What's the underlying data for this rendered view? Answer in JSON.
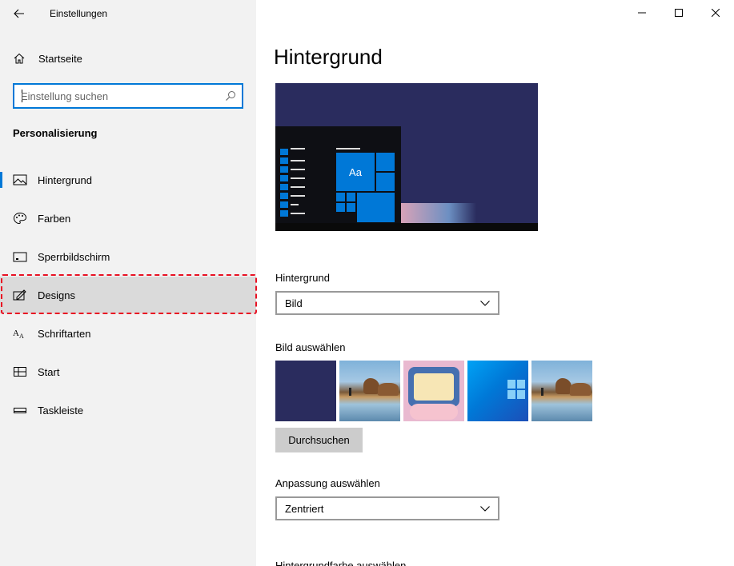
{
  "window": {
    "title": "Einstellungen",
    "controls": {
      "minimize": "minimize-icon",
      "maximize": "maximize-icon",
      "close": "close-icon"
    }
  },
  "sidebar": {
    "home_label": "Startseite",
    "search": {
      "placeholder": "Einstellung suchen",
      "value": ""
    },
    "section_title": "Personalisierung",
    "selected": "Hintergrund",
    "highlighted": "Designs",
    "accent": "#0078d7",
    "annotation_color": "#e81123",
    "items": [
      {
        "label": "Hintergrund",
        "icon": "picture-icon"
      },
      {
        "label": "Farben",
        "icon": "palette-icon"
      },
      {
        "label": "Sperrbildschirm",
        "icon": "lock-screen-icon"
      },
      {
        "label": "Designs",
        "icon": "themes-icon"
      },
      {
        "label": "Schriftarten",
        "icon": "font-icon"
      },
      {
        "label": "Start",
        "icon": "start-icon"
      },
      {
        "label": "Taskleiste",
        "icon": "taskbar-icon"
      }
    ]
  },
  "main": {
    "title": "Hintergrund",
    "preview": {
      "tile_label": "Aa"
    },
    "background_label": "Hintergrund",
    "background_value": "Bild",
    "choose_picture_label": "Bild auswählen",
    "thumbnails": [
      "solid-navy",
      "beach-rocks",
      "cute-illustration",
      "windows-blue",
      "beach-rocks"
    ],
    "browse_label": "Durchsuchen",
    "fit_label": "Anpassung auswählen",
    "fit_value": "Zentriert",
    "cut_off_label": "Hintergrundfarbe auswählen"
  }
}
